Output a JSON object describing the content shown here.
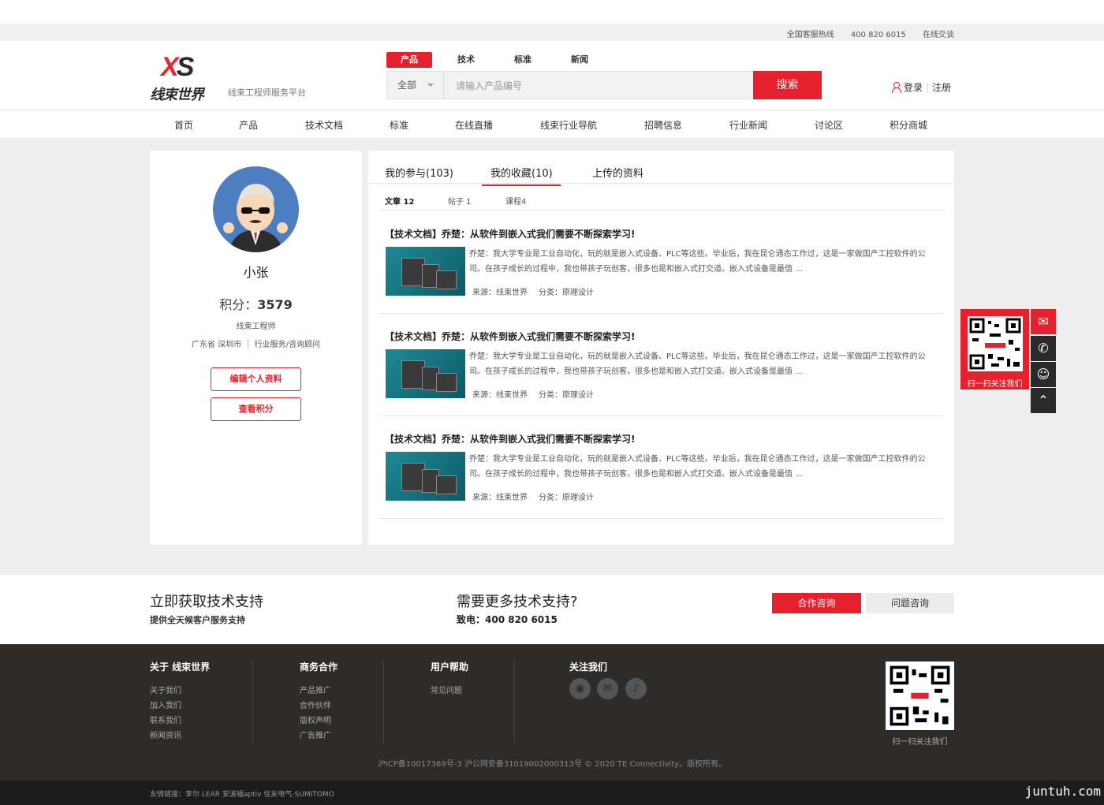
{
  "topbar": {
    "hotline_label": "全国客服热线",
    "hotline": "400 820 6015",
    "chat": "在线交谈"
  },
  "brand": {
    "logo": "XS",
    "logo_cn": "线束世界",
    "slogan": "线束工程师服务平台",
    "accent": "#e4212d"
  },
  "search": {
    "tabs": [
      "产品",
      "技术",
      "标准",
      "新闻"
    ],
    "category": "全部",
    "placeholder": "请输入产品编号",
    "button": "搜索"
  },
  "auth": {
    "login": "登录",
    "register": "注册"
  },
  "nav": [
    "首页",
    "产品",
    "技术文档",
    "标准",
    "在线直播",
    "线束行业导航",
    "招聘信息",
    "行业新闻",
    "讨论区",
    "积分商城"
  ],
  "profile": {
    "name": "小张",
    "score_label": "积分：",
    "score": "3579",
    "title": "线束工程师",
    "location": "广东省 深圳市 ｜ 行业服务/咨询顾问",
    "edit": "编辑个人资料",
    "points": "查看积分"
  },
  "tabs": [
    "我的参与(103)",
    "我的收藏(10)",
    "上传的资料"
  ],
  "subtabs": [
    "文章 12",
    "帖子 1",
    "课程4"
  ],
  "items": [
    {
      "title": "【技术文档】乔楚：从软件到嵌入式我们需要不断探索学习!",
      "desc": "乔楚：我大学专业是工业自动化，玩的就是嵌入式设备、PLC等这些。毕业后，我在昆仑通态工作过，这是一家做国产工控软件的公司。在孩子成长的过程中，我也带孩子玩创客，很多也是和嵌入式打交道。嵌入式设备是最值 ...",
      "source": "来源：线束世界",
      "category": "分类：原理设计"
    },
    {
      "title": "【技术文档】乔楚：从软件到嵌入式我们需要不断探索学习!",
      "desc": "乔楚：我大学专业是工业自动化，玩的就是嵌入式设备、PLC等这些。毕业后，我在昆仑通态工作过，这是一家做国产工控软件的公司。在孩子成长的过程中，我也带孩子玩创客，很多也是和嵌入式打交道。嵌入式设备是最值 ...",
      "source": "来源：线束世界",
      "category": "分类：原理设计"
    },
    {
      "title": "【技术文档】乔楚：从软件到嵌入式我们需要不断探索学习!",
      "desc": "乔楚：我大学专业是工业自动化，玩的就是嵌入式设备、PLC等这些。毕业后，我在昆仑通态工作过，这是一家做国产工控软件的公司。在孩子成长的过程中，我也带孩子玩创客，很多也是和嵌入式打交道。嵌入式设备是最值 ...",
      "source": "来源：线束世界",
      "category": "分类：原理设计"
    }
  ],
  "side": {
    "qr_label": "扫一扫关注我们"
  },
  "support": {
    "title": "立即获取技术支持",
    "sub": "提供全天候客户服务支持",
    "title2": "需要更多技术支持?",
    "phone": "致电：400 820 6015",
    "btn1": "合作咨询",
    "btn2": "问题咨询"
  },
  "footer": {
    "cols": [
      {
        "h": "关于 线束世界",
        "items": [
          "关于我们",
          "加入我们",
          "联系我们",
          "新闻资讯"
        ]
      },
      {
        "h": "商务合作",
        "items": [
          "产品推广",
          "合作伙伴",
          "版权声明",
          "广告推广"
        ]
      },
      {
        "h": "用户帮助",
        "items": [
          "常见问题"
        ]
      },
      {
        "h": "关注我们",
        "items": []
      }
    ],
    "qr_label": "扫一扫关注我们",
    "icp": "沪ICP备10017369号-3  沪公网安备31019002000313号  © 2020 TE Connectivity。版权所有。",
    "links": "友情链接：李尔 LEAR    安波福aptiv    住友电气-SUMITOMO",
    "watermark": "juntuh.com"
  }
}
